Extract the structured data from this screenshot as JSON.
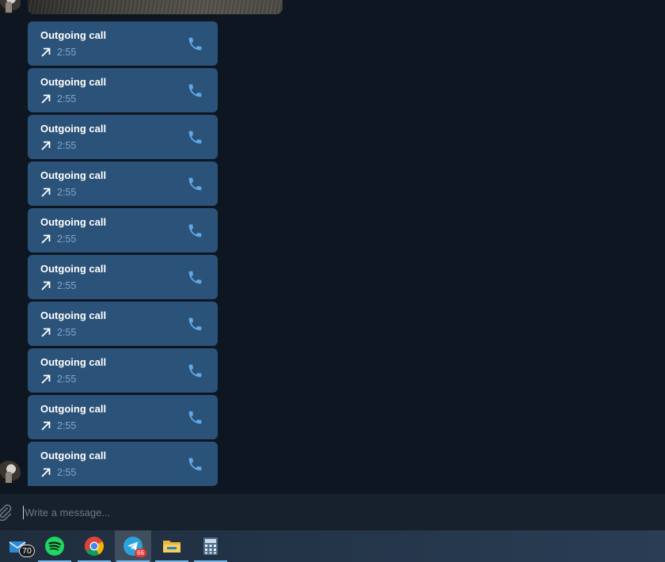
{
  "calls": [
    {
      "title": "Outgoing call",
      "duration": "2:55"
    },
    {
      "title": "Outgoing call",
      "duration": "2:55"
    },
    {
      "title": "Outgoing call",
      "duration": "2:55"
    },
    {
      "title": "Outgoing call",
      "duration": "2:55"
    },
    {
      "title": "Outgoing call",
      "duration": "2:55"
    },
    {
      "title": "Outgoing call",
      "duration": "2:55"
    },
    {
      "title": "Outgoing call",
      "duration": "2:55"
    },
    {
      "title": "Outgoing call",
      "duration": "2:55"
    },
    {
      "title": "Outgoing call",
      "duration": "2:55"
    },
    {
      "title": "Outgoing call",
      "duration": "2:55"
    }
  ],
  "call_icons": {
    "direction": "outgoing-arrow-icon",
    "action": "phone-icon"
  },
  "composer": {
    "placeholder": "Write a message..."
  },
  "taskbar": {
    "apps": [
      {
        "name": "mail",
        "icon": "mail-icon",
        "badge": "70"
      },
      {
        "name": "spotify",
        "icon": "spotify-icon"
      },
      {
        "name": "chrome",
        "icon": "chrome-icon"
      },
      {
        "name": "telegram",
        "icon": "telegram-icon",
        "badge": "66",
        "active": true
      },
      {
        "name": "file-explorer",
        "icon": "folder-icon"
      },
      {
        "name": "calculator",
        "icon": "calculator-icon"
      }
    ]
  },
  "colors": {
    "chat_background": "#0e1621",
    "bubble": "#2b5278",
    "accent": "#5fa9e8",
    "duration_text": "#7fa7cc",
    "composer_background": "#17212b"
  }
}
